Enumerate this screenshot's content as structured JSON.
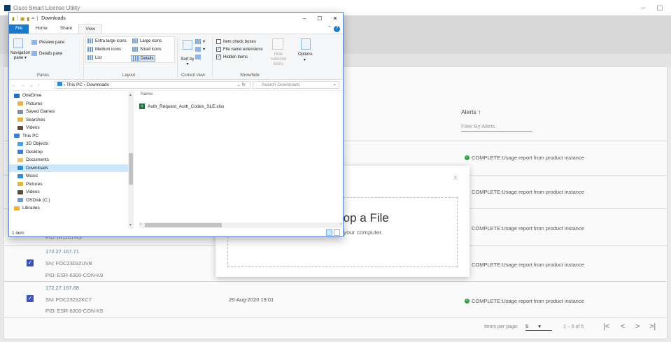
{
  "app": {
    "title": "Cisco Smart License Utility",
    "minimize": "–",
    "restore": "▢"
  },
  "alerts": {
    "header": "Alerts ↑",
    "filter_placeholder": "Filter By Alerts",
    "items": [
      "COMPLETE:Usage report from product instance",
      "COMPLETE:Usage report from product instance",
      "COMPLETE:Usage report from product instance",
      "COMPLETE:Usage report from product instance",
      "COMPLETE:Usage report from product instance"
    ]
  },
  "devices": {
    "partial_pid": "PID: IR1101-K9",
    "rows": [
      {
        "ip": "172.27.167.71",
        "sn": "SN: FOC23032UVB",
        "pid": "PID: ESR-6300-CON-K9",
        "date": ""
      },
      {
        "ip": "172.27.167.68",
        "sn": "SN: FOC23232KC7",
        "pid": "PID: ESR-6300-CON-K9",
        "date": "26-Aug-2020 19:01"
      }
    ]
  },
  "pagination": {
    "label": "Items per page:",
    "per_page": "5",
    "range": "1 – 5 of 5",
    "first": "|<",
    "prev": "<",
    "next": ">",
    "last": ">|"
  },
  "dialog": {
    "close": "X",
    "title": "rop a File",
    "subtitle": "your computer."
  },
  "explorer": {
    "title": "Downloads",
    "qa_sep": "| ",
    "qa_dropdown": "=",
    "qa_pin": "|",
    "win_min": "–",
    "win_max": "☐",
    "win_close": "✕",
    "tabs": [
      "File",
      "Home",
      "Share",
      "View"
    ],
    "ribbon": {
      "navigation_pane": "Navigation pane ▾",
      "preview_pane": "Preview pane",
      "details_pane": "Details pane",
      "panes_label": "Panes",
      "layout_items": [
        "Extra large icons",
        "Large icons",
        "Medium icons",
        "Small icons",
        "List",
        "Details"
      ],
      "layout_label": "Layout",
      "sort_by": "Sort by ▾",
      "current_view_label": "Current view",
      "item_check_boxes": "Item check boxes",
      "file_name_extensions": "File name extensions",
      "hidden_items": "Hidden items",
      "hide_selected": "Hide selected items",
      "options": "Options",
      "show_hide_label": "Show/hide"
    },
    "address": {
      "nav": "← → ⌄ ↑",
      "path": "›  This PC  ›  Downloads",
      "refresh": "⌄ ↻",
      "search_placeholder": "Search Downloads"
    },
    "nav_items": [
      {
        "label": "OneDrive",
        "color": "#1e70c8"
      },
      {
        "label": "Pictures",
        "color": "#e8b53a"
      },
      {
        "label": "Saved Games",
        "color": "#7a8fa8"
      },
      {
        "label": "Searches",
        "color": "#e8b53a"
      },
      {
        "label": "Videos",
        "color": "#5a4a3a"
      },
      {
        "label": "This PC",
        "color": "#3b7dd8"
      },
      {
        "label": "3D Objects",
        "color": "#4aa0e0"
      },
      {
        "label": "Desktop",
        "color": "#3b7dd8"
      },
      {
        "label": "Documents",
        "color": "#e8c46a"
      },
      {
        "label": "Downloads",
        "color": "#2c8fdb"
      },
      {
        "label": "Music",
        "color": "#2c8fdb"
      },
      {
        "label": "Pictures",
        "color": "#e8b53a"
      },
      {
        "label": "Videos",
        "color": "#5a4a3a"
      },
      {
        "label": "OSDisk (C:)",
        "color": "#6e9ad4"
      },
      {
        "label": "Libraries",
        "color": "#e8b53a"
      }
    ],
    "column_name": "Name",
    "file_name": "Auth_Request_Auth_Codes_SLE.xlsx",
    "status": "1 item"
  }
}
